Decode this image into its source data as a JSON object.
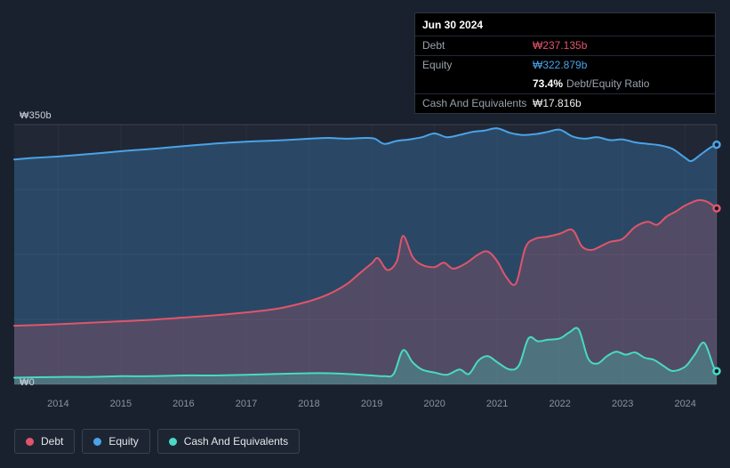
{
  "colors": {
    "background": "#1a212e",
    "debt": "#e0556b",
    "equity": "#4aa3e8",
    "cash": "#49d9c5"
  },
  "tooltip": {
    "date": "Jun 30 2024",
    "debt_label": "Debt",
    "debt_value": "₩237.135b",
    "equity_label": "Equity",
    "equity_value": "₩322.879b",
    "ratio_value": "73.4%",
    "ratio_label": "Debt/Equity Ratio",
    "cash_label": "Cash And Equivalents",
    "cash_value": "₩17.816b"
  },
  "legend": {
    "items": [
      {
        "label": "Debt",
        "color": "#e0556b"
      },
      {
        "label": "Equity",
        "color": "#4aa3e8"
      },
      {
        "label": "Cash And Equivalents",
        "color": "#49d9c5"
      }
    ]
  },
  "chart_data": {
    "type": "area",
    "unit": "₩b",
    "xlim": [
      2013.3,
      2024.5
    ],
    "ylim": [
      0,
      350
    ],
    "x_ticks": [
      2014,
      2015,
      2016,
      2017,
      2018,
      2019,
      2020,
      2021,
      2022,
      2023,
      2024
    ],
    "y_gridlines": [
      0,
      87.5,
      175,
      262.5,
      350
    ],
    "y_axis": {
      "top_label": "₩350b",
      "bottom_label": "₩0"
    },
    "legend_position": "bottom-left",
    "grid": true,
    "hover_x": 2024.5,
    "series": [
      {
        "name": "Equity",
        "slug": "equity",
        "color": "#4aa3e8",
        "fill": "rgba(62,150,215,0.30)",
        "points": [
          [
            2013.3,
            303
          ],
          [
            2013.6,
            305
          ],
          [
            2014,
            307
          ],
          [
            2014.3,
            309
          ],
          [
            2014.6,
            311
          ],
          [
            2015,
            314
          ],
          [
            2015.3,
            316
          ],
          [
            2015.6,
            318
          ],
          [
            2016,
            321
          ],
          [
            2016.3,
            323
          ],
          [
            2016.6,
            325
          ],
          [
            2017,
            327
          ],
          [
            2017.3,
            328
          ],
          [
            2017.6,
            329
          ],
          [
            2018,
            331
          ],
          [
            2018.3,
            332
          ],
          [
            2018.6,
            331
          ],
          [
            2018.9,
            332
          ],
          [
            2019.05,
            331
          ],
          [
            2019.2,
            324
          ],
          [
            2019.4,
            328
          ],
          [
            2019.6,
            330
          ],
          [
            2019.8,
            333
          ],
          [
            2020,
            338
          ],
          [
            2020.2,
            333
          ],
          [
            2020.4,
            336
          ],
          [
            2020.6,
            340
          ],
          [
            2020.8,
            342
          ],
          [
            2021,
            345
          ],
          [
            2021.2,
            339
          ],
          [
            2021.4,
            336
          ],
          [
            2021.6,
            337
          ],
          [
            2021.8,
            340
          ],
          [
            2022,
            343
          ],
          [
            2022.2,
            334
          ],
          [
            2022.4,
            331
          ],
          [
            2022.6,
            333
          ],
          [
            2022.8,
            329
          ],
          [
            2023,
            330
          ],
          [
            2023.2,
            326
          ],
          [
            2023.4,
            324
          ],
          [
            2023.6,
            322
          ],
          [
            2023.8,
            317
          ],
          [
            2024,
            305
          ],
          [
            2024.1,
            301
          ],
          [
            2024.25,
            310
          ],
          [
            2024.4,
            319
          ],
          [
            2024.5,
            322.879
          ]
        ]
      },
      {
        "name": "Debt",
        "slug": "debt",
        "color": "#e0556b",
        "fill": "rgba(226,86,106,0.22)",
        "points": [
          [
            2013.3,
            79
          ],
          [
            2013.7,
            80
          ],
          [
            2014,
            81
          ],
          [
            2014.5,
            83
          ],
          [
            2015,
            85
          ],
          [
            2015.5,
            87
          ],
          [
            2016,
            90
          ],
          [
            2016.5,
            93
          ],
          [
            2017,
            97
          ],
          [
            2017.5,
            102
          ],
          [
            2018,
            112
          ],
          [
            2018.3,
            121
          ],
          [
            2018.6,
            135
          ],
          [
            2018.8,
            149
          ],
          [
            2019,
            163
          ],
          [
            2019.1,
            170
          ],
          [
            2019.25,
            154
          ],
          [
            2019.4,
            166
          ],
          [
            2019.5,
            200
          ],
          [
            2019.65,
            172
          ],
          [
            2019.8,
            161
          ],
          [
            2020,
            158
          ],
          [
            2020.15,
            164
          ],
          [
            2020.3,
            156
          ],
          [
            2020.5,
            163
          ],
          [
            2020.7,
            175
          ],
          [
            2020.85,
            179
          ],
          [
            2021,
            166
          ],
          [
            2021.15,
            144
          ],
          [
            2021.3,
            136
          ],
          [
            2021.45,
            184
          ],
          [
            2021.6,
            196
          ],
          [
            2021.8,
            199
          ],
          [
            2022,
            203
          ],
          [
            2022.2,
            208
          ],
          [
            2022.35,
            186
          ],
          [
            2022.5,
            181
          ],
          [
            2022.65,
            186
          ],
          [
            2022.8,
            192
          ],
          [
            2023,
            196
          ],
          [
            2023.2,
            212
          ],
          [
            2023.4,
            219
          ],
          [
            2023.55,
            215
          ],
          [
            2023.7,
            226
          ],
          [
            2023.85,
            233
          ],
          [
            2024,
            241
          ],
          [
            2024.2,
            248
          ],
          [
            2024.35,
            246
          ],
          [
            2024.5,
            237.135
          ]
        ]
      },
      {
        "name": "Cash And Equivalents",
        "slug": "cash",
        "color": "#49d9c5",
        "fill": "rgba(70,216,194,0.28)",
        "points": [
          [
            2013.3,
            9
          ],
          [
            2014,
            10
          ],
          [
            2014.5,
            10
          ],
          [
            2015,
            11
          ],
          [
            2015.5,
            11
          ],
          [
            2016,
            12
          ],
          [
            2016.5,
            12
          ],
          [
            2017,
            13
          ],
          [
            2017.5,
            14
          ],
          [
            2018,
            15
          ],
          [
            2018.3,
            15
          ],
          [
            2018.6,
            14
          ],
          [
            2019,
            12
          ],
          [
            2019.2,
            11
          ],
          [
            2019.35,
            14
          ],
          [
            2019.5,
            46
          ],
          [
            2019.65,
            30
          ],
          [
            2019.8,
            20
          ],
          [
            2020,
            16
          ],
          [
            2020.2,
            13
          ],
          [
            2020.4,
            20
          ],
          [
            2020.55,
            14
          ],
          [
            2020.7,
            32
          ],
          [
            2020.85,
            38
          ],
          [
            2021,
            30
          ],
          [
            2021.2,
            20
          ],
          [
            2021.35,
            26
          ],
          [
            2021.5,
            62
          ],
          [
            2021.65,
            58
          ],
          [
            2021.8,
            60
          ],
          [
            2022,
            62
          ],
          [
            2022.15,
            70
          ],
          [
            2022.3,
            74
          ],
          [
            2022.45,
            35
          ],
          [
            2022.6,
            28
          ],
          [
            2022.75,
            38
          ],
          [
            2022.9,
            44
          ],
          [
            2023.05,
            40
          ],
          [
            2023.2,
            43
          ],
          [
            2023.35,
            36
          ],
          [
            2023.5,
            33
          ],
          [
            2023.65,
            25
          ],
          [
            2023.8,
            18
          ],
          [
            2024,
            24
          ],
          [
            2024.15,
            40
          ],
          [
            2024.3,
            56
          ],
          [
            2024.45,
            24
          ],
          [
            2024.5,
            17.816
          ]
        ]
      }
    ]
  }
}
